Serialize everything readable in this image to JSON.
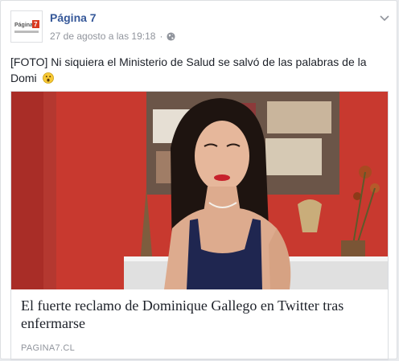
{
  "post": {
    "page_name": "Página 7",
    "timestamp": "27 de agosto a las 19:18",
    "separator": "·",
    "privacy_icon": "globe-icon",
    "options_icon": "chevron-down-icon",
    "text": "[FOTO] Ni siquiera el Ministerio de Salud se salvó de las palabras de la Domi",
    "emoji": "surprised-face-emoji"
  },
  "avatar": {
    "logo_text": "Página 7",
    "brand_color": "#d93a20"
  },
  "link": {
    "title": "El fuerte reclamo de Dominique Gallego en Twitter tras enfermarse",
    "domain": "PAGINA7.CL"
  },
  "colors": {
    "link_blue": "#365899",
    "meta_gray": "#90949c",
    "text": "#1d2129",
    "wall_red": "#cc3b34"
  }
}
